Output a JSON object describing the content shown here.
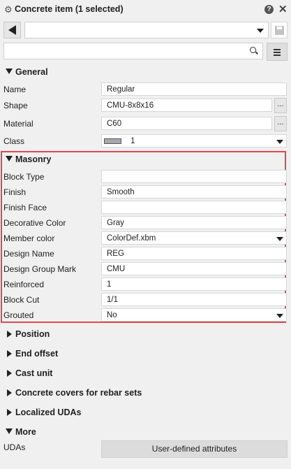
{
  "window": {
    "title": "Concrete item (1 selected)",
    "help_icon": "?",
    "close_icon": "✕"
  },
  "toolbar": {
    "preset_value": "",
    "search_value": "",
    "search_placeholder": ""
  },
  "sections": {
    "general": "General",
    "masonry": "Masonry",
    "position": "Position",
    "end_offset": "End offset",
    "cast_unit": "Cast unit",
    "concrete_covers": "Concrete covers for rebar sets",
    "localized_udas": "Localized UDAs",
    "more": "More"
  },
  "general": {
    "name": {
      "label": "Name",
      "value": "Regular"
    },
    "shape": {
      "label": "Shape",
      "value": "CMU-8x8x16"
    },
    "material": {
      "label": "Material",
      "value": "C60"
    },
    "class": {
      "label": "Class",
      "value": "1",
      "swatch_color": "#a9a6b0"
    }
  },
  "masonry": {
    "block_type": {
      "label": "Block Type",
      "value": ""
    },
    "finish": {
      "label": "Finish",
      "value": "Smooth"
    },
    "finish_face": {
      "label": "Finish Face",
      "value": ""
    },
    "decorative_color": {
      "label": "Decorative Color",
      "value": "Gray"
    },
    "member_color": {
      "label": "Member color",
      "value": "ColorDef.xbm"
    },
    "design_name": {
      "label": "Design Name",
      "value": "REG"
    },
    "design_group_mark": {
      "label": "Design Group Mark",
      "value": "CMU"
    },
    "reinforced": {
      "label": "Reinforced",
      "value": "1"
    },
    "block_cut": {
      "label": "Block Cut",
      "value": "1/1"
    },
    "grouted": {
      "label": "Grouted",
      "value": "No"
    }
  },
  "more": {
    "udas_label": "UDAs",
    "udas_button": "User-defined attributes"
  },
  "ellipsis": "...",
  "colors": {
    "highlight": "#e0474c"
  }
}
